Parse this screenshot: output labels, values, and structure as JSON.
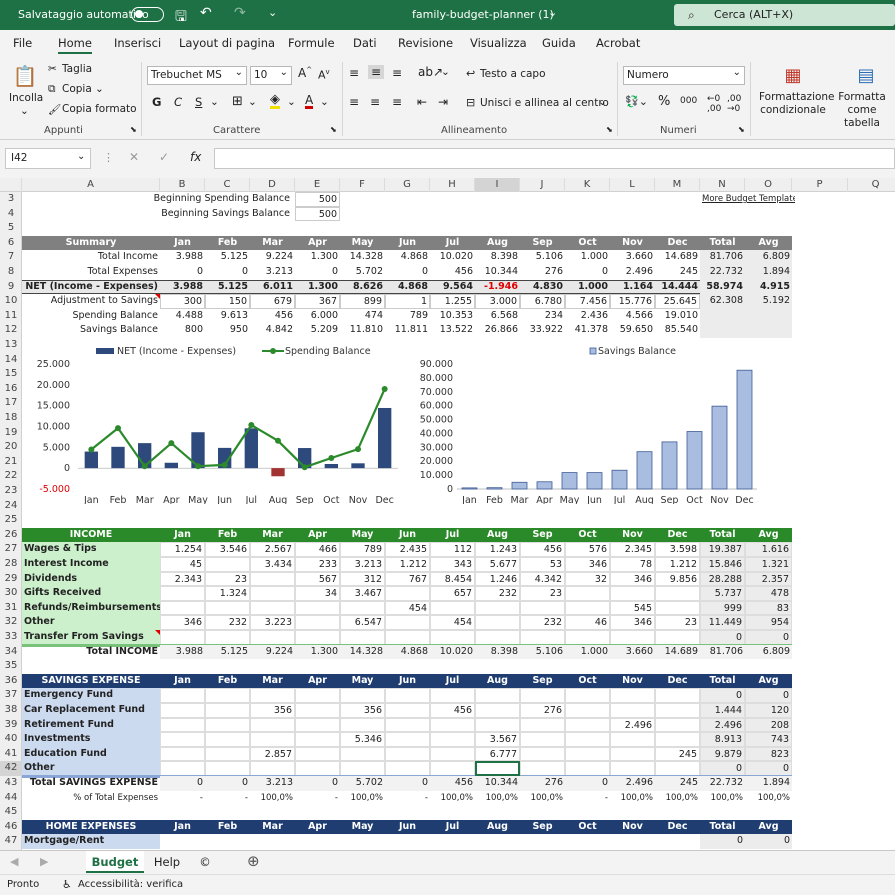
{
  "titlebar": {
    "autosave": "Salvataggio automatico",
    "filename": "family-budget-planner (1)",
    "search": "Cerca (ALT+X)"
  },
  "menu": [
    "File",
    "Home",
    "Inserisci",
    "Layout di pagina",
    "Formule",
    "Dati",
    "Revisione",
    "Visualizza",
    "Guida",
    "Acrobat"
  ],
  "ribbon": {
    "paste": "Incolla",
    "cut": "Taglia",
    "copy": "Copia",
    "format_painter": "Copia formato",
    "clipboard": "Appunti",
    "font_name": "Trebuchet MS",
    "font_size": "10",
    "font_group": "Carattere",
    "wrap": "Testo a capo",
    "merge": "Unisci e allinea al centro",
    "align_group": "Allineamento",
    "number_format": "Numero",
    "number_group": "Numeri",
    "cond_format": "Formattazione condizionale",
    "format_table": "Formatta come tabella",
    "bold": "G",
    "italic": "C",
    "underline": "S"
  },
  "formula_bar": {
    "namebox": "I42",
    "formula": ""
  },
  "columns": [
    "A",
    "B",
    "C",
    "D",
    "E",
    "F",
    "G",
    "H",
    "I",
    "J",
    "K",
    "L",
    "M",
    "N",
    "O",
    "P",
    "Q"
  ],
  "rows": [
    "3",
    "4",
    "5",
    "6",
    "7",
    "8",
    "9",
    "10",
    "11",
    "12",
    "13",
    "14",
    "15",
    "16",
    "17",
    "18",
    "19",
    "20",
    "21",
    "22",
    "23",
    "24",
    "25",
    "26",
    "27",
    "28",
    "29",
    "30",
    "31",
    "32",
    "33",
    "34",
    "35",
    "36",
    "37",
    "38",
    "39",
    "40",
    "41",
    "42",
    "43",
    "44",
    "45",
    "46",
    "47"
  ],
  "header_cells": {
    "begin_spending": "Beginning Spending Balance",
    "begin_spending_val": "500",
    "begin_savings": "Beginning Savings Balance",
    "begin_savings_val": "500",
    "more_templates": "More Budget Templates"
  },
  "months": [
    "Jan",
    "Feb",
    "Mar",
    "Apr",
    "May",
    "Jun",
    "Jul",
    "Aug",
    "Sep",
    "Oct",
    "Nov",
    "Dec",
    "Total",
    "Avg"
  ],
  "summary": {
    "title": "Summary",
    "rows": [
      {
        "label": "Total Income",
        "vals": [
          "3.988",
          "5.125",
          "9.224",
          "1.300",
          "14.328",
          "4.868",
          "10.020",
          "8.398",
          "5.106",
          "1.000",
          "3.660",
          "14.689",
          "81.706",
          "6.809"
        ]
      },
      {
        "label": "Total Expenses",
        "vals": [
          "0",
          "0",
          "3.213",
          "0",
          "5.702",
          "0",
          "456",
          "10.344",
          "276",
          "0",
          "2.496",
          "245",
          "22.732",
          "1.894"
        ]
      },
      {
        "label": "NET (Income - Expenses)",
        "vals": [
          "3.988",
          "5.125",
          "6.011",
          "1.300",
          "8.626",
          "4.868",
          "9.564",
          "-1.946",
          "4.830",
          "1.000",
          "1.164",
          "14.444",
          "58.974",
          "4.915"
        ]
      },
      {
        "label": "Adjustment to Savings",
        "vals": [
          "300",
          "150",
          "679",
          "367",
          "899",
          "1",
          "1.255",
          "3.000",
          "6.780",
          "7.456",
          "15.776",
          "25.645",
          "62.308",
          "5.192"
        ]
      },
      {
        "label": "Spending Balance",
        "vals": [
          "4.488",
          "9.613",
          "456",
          "6.000",
          "474",
          "789",
          "10.353",
          "6.568",
          "234",
          "2.436",
          "4.566",
          "19.010",
          "",
          ""
        ]
      },
      {
        "label": "Savings Balance",
        "vals": [
          "800",
          "950",
          "4.842",
          "5.209",
          "11.810",
          "11.811",
          "13.522",
          "26.866",
          "33.922",
          "41.378",
          "59.650",
          "85.540",
          "",
          ""
        ]
      }
    ]
  },
  "income": {
    "title": "INCOME",
    "rows": [
      {
        "label": "Wages & Tips",
        "vals": [
          "1.254",
          "3.546",
          "2.567",
          "466",
          "789",
          "2.435",
          "112",
          "1.243",
          "456",
          "576",
          "2.345",
          "3.598",
          "19.387",
          "1.616"
        ]
      },
      {
        "label": "Interest Income",
        "vals": [
          "45",
          "",
          "3.434",
          "233",
          "3.213",
          "1.212",
          "343",
          "5.677",
          "53",
          "346",
          "78",
          "1.212",
          "15.846",
          "1.321"
        ]
      },
      {
        "label": "Dividends",
        "vals": [
          "2.343",
          "23",
          "",
          "567",
          "312",
          "767",
          "8.454",
          "1.246",
          "4.342",
          "32",
          "346",
          "9.856",
          "28.288",
          "2.357"
        ]
      },
      {
        "label": "Gifts Received",
        "vals": [
          "",
          "1.324",
          "",
          "34",
          "3.467",
          "",
          "657",
          "232",
          "23",
          "",
          "",
          "",
          "5.737",
          "478"
        ]
      },
      {
        "label": "Refunds/Reimbursements",
        "vals": [
          "",
          "",
          "",
          "",
          "",
          "454",
          "",
          "",
          "",
          "",
          "545",
          "",
          "999",
          "83"
        ]
      },
      {
        "label": "Other",
        "vals": [
          "346",
          "232",
          "3.223",
          "",
          "6.547",
          "",
          "454",
          "",
          "232",
          "46",
          "346",
          "23",
          "11.449",
          "954"
        ]
      },
      {
        "label": "Transfer From Savings",
        "vals": [
          "",
          "",
          "",
          "",
          "",
          "",
          "",
          "",
          "",
          "",
          "",
          "",
          "0",
          "0"
        ]
      }
    ],
    "total_label": "Total INCOME",
    "total": [
      "3.988",
      "5.125",
      "9.224",
      "1.300",
      "14.328",
      "4.868",
      "10.020",
      "8.398",
      "5.106",
      "1.000",
      "3.660",
      "14.689",
      "81.706",
      "6.809"
    ]
  },
  "savings": {
    "title": "SAVINGS EXPENSE",
    "rows": [
      {
        "label": "Emergency Fund",
        "vals": [
          "",
          "",
          "",
          "",
          "",
          "",
          "",
          "",
          "",
          "",
          "",
          "",
          "0",
          "0"
        ]
      },
      {
        "label": "Car Replacement Fund",
        "vals": [
          "",
          "",
          "356",
          "",
          "356",
          "",
          "456",
          "",
          "276",
          "",
          "",
          "",
          "1.444",
          "120"
        ]
      },
      {
        "label": "Retirement Fund",
        "vals": [
          "",
          "",
          "",
          "",
          "",
          "",
          "",
          "",
          "",
          "",
          "2.496",
          "",
          "2.496",
          "208"
        ]
      },
      {
        "label": "Investments",
        "vals": [
          "",
          "",
          "",
          "",
          "5.346",
          "",
          "",
          "3.567",
          "",
          "",
          "",
          "",
          "8.913",
          "743"
        ]
      },
      {
        "label": "Education Fund",
        "vals": [
          "",
          "",
          "2.857",
          "",
          "",
          "",
          "",
          "6.777",
          "",
          "",
          "",
          "245",
          "9.879",
          "823"
        ]
      },
      {
        "label": "Other",
        "vals": [
          "",
          "",
          "",
          "",
          "",
          "",
          "",
          "",
          "",
          "",
          "",
          "",
          "0",
          "0"
        ]
      }
    ],
    "total_label": "Total SAVINGS EXPENSE",
    "total": [
      "0",
      "0",
      "3.213",
      "0",
      "5.702",
      "0",
      "456",
      "10.344",
      "276",
      "0",
      "2.496",
      "245",
      "22.732",
      "1.894"
    ],
    "pct_label": "% of Total Expenses",
    "pct": [
      "-",
      "-",
      "100,0%",
      "-",
      "100,0%",
      "-",
      "100,0%",
      "100,0%",
      "100,0%",
      "-",
      "100,0%",
      "100,0%",
      "100,0%",
      "100,0%"
    ]
  },
  "home": {
    "title": "HOME EXPENSES",
    "first_row": "Mortgage/Rent",
    "first_vals": [
      "",
      "",
      "",
      "",
      "",
      "",
      "",
      "",
      "",
      "",
      "",
      "",
      "0",
      "0"
    ]
  },
  "chart_data": [
    {
      "type": "bar",
      "title": "",
      "series": [
        {
          "name": "NET (Income - Expenses)",
          "type": "bar",
          "values": [
            3988,
            5125,
            6011,
            1300,
            8626,
            4868,
            9564,
            -1946,
            4830,
            1000,
            1164,
            14444
          ]
        },
        {
          "name": "Spending Balance",
          "type": "line",
          "values": [
            4488,
            9613,
            456,
            6000,
            474,
            789,
            10353,
            6568,
            234,
            2436,
            4566,
            19010
          ]
        }
      ],
      "categories": [
        "Jan",
        "Feb",
        "Mar",
        "Apr",
        "May",
        "Jun",
        "Jul",
        "Aug",
        "Sep",
        "Oct",
        "Nov",
        "Dec"
      ],
      "yticks": [
        "25.000",
        "20.000",
        "15.000",
        "10.000",
        "5.000",
        "0",
        "-5.000"
      ],
      "ylim": [
        -5000,
        25000
      ],
      "colors": {
        "bar": "#2e4a7c",
        "bar_neg": "#a33333",
        "line": "#2b8a2b"
      }
    },
    {
      "type": "bar",
      "title": "",
      "series": [
        {
          "name": "Savings Balance",
          "values": [
            800,
            950,
            4842,
            5209,
            11810,
            11811,
            13522,
            26866,
            33922,
            41378,
            59650,
            85540
          ]
        }
      ],
      "categories": [
        "Jan",
        "Feb",
        "Mar",
        "Apr",
        "May",
        "Jun",
        "Jul",
        "Aug",
        "Sep",
        "Oct",
        "Nov",
        "Dec"
      ],
      "yticks": [
        "90.000",
        "80.000",
        "70.000",
        "60.000",
        "50.000",
        "40.000",
        "30.000",
        "20.000",
        "10.000",
        "0"
      ],
      "ylim": [
        0,
        90000
      ],
      "colors": {
        "bar": "#a8bde0",
        "border": "#3d5a96"
      }
    }
  ],
  "sheet_tabs": [
    "Budget",
    "Help",
    "©"
  ],
  "status": {
    "ready": "Pronto",
    "accessibility": "Accessibilità: verifica"
  },
  "colors": {
    "excel_green": "#1e7145",
    "summary_gray": "#808080",
    "income_green": "#2a8a2a",
    "savings_navy": "#1f3d70",
    "income_label_bg": "#ccefcc",
    "savings_label_bg": "#ccdaf0"
  }
}
